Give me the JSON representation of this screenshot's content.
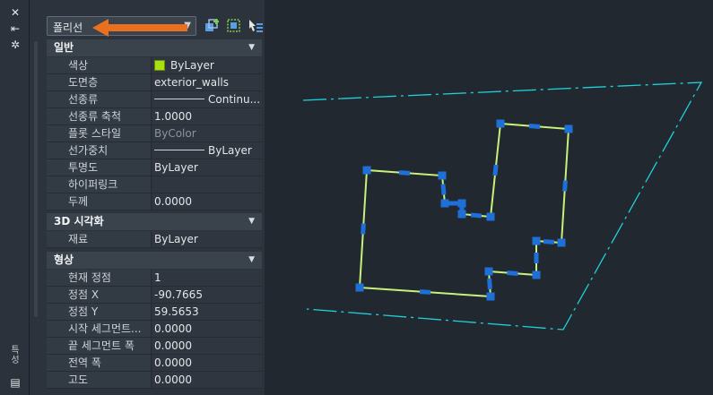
{
  "selector": {
    "value": "폴리선"
  },
  "vertical_title": "특성",
  "sections": {
    "general": {
      "title": "일반",
      "rows": [
        {
          "label": "색상",
          "value": "ByLayer"
        },
        {
          "label": "도면층",
          "value": "exterior_walls"
        },
        {
          "label": "선종류",
          "value": "Continu..."
        },
        {
          "label": "선종류 축척",
          "value": "1.0000"
        },
        {
          "label": "플롯 스타일",
          "value": "ByColor"
        },
        {
          "label": "선가중치",
          "value": "ByLayer"
        },
        {
          "label": "투명도",
          "value": "ByLayer"
        },
        {
          "label": "하이퍼링크",
          "value": ""
        },
        {
          "label": "두께",
          "value": "0.0000"
        }
      ]
    },
    "viz3d": {
      "title": "3D 시각화",
      "rows": [
        {
          "label": "재료",
          "value": "ByLayer"
        }
      ]
    },
    "geometry": {
      "title": "형상",
      "rows": [
        {
          "label": "현재 정점",
          "value": "1"
        },
        {
          "label": "정점 X",
          "value": "-90.7665"
        },
        {
          "label": "정점 Y",
          "value": "59.5653"
        },
        {
          "label": "시작 세그먼트...",
          "value": "0.0000"
        },
        {
          "label": "끝 세그먼트 폭",
          "value": "0.0000"
        },
        {
          "label": "전역 폭",
          "value": "0.0000"
        },
        {
          "label": "고도",
          "value": "0.0000"
        }
      ]
    }
  },
  "colors": {
    "swatch": "#a8e010",
    "polyline": "#c9f07a",
    "grip": "#1f6fd8",
    "boundary": "#1fd0d8",
    "arrow": "#e8701e"
  }
}
